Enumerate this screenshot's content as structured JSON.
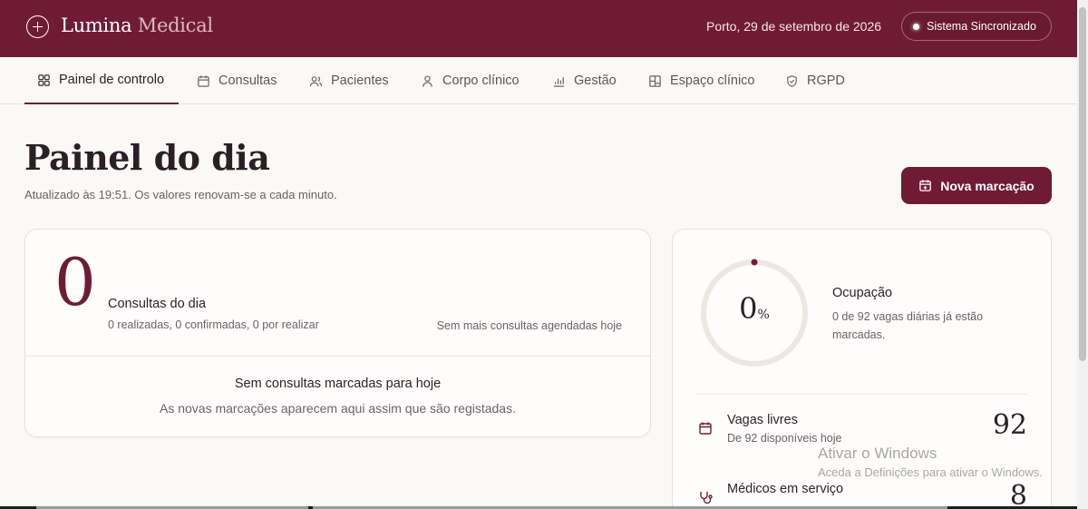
{
  "header": {
    "brand_primary": "Lumina",
    "brand_secondary": "Medical",
    "date": "Porto, 29 de setembro de 2026",
    "sync_status": "Sistema Sincronizado"
  },
  "nav": {
    "items": [
      {
        "label": "Painel de controlo",
        "icon": "dashboard-icon",
        "active": true
      },
      {
        "label": "Consultas",
        "icon": "calendar-icon"
      },
      {
        "label": "Pacientes",
        "icon": "users-icon"
      },
      {
        "label": "Corpo clínico",
        "icon": "user-icon"
      },
      {
        "label": "Gestão",
        "icon": "bar-chart-icon"
      },
      {
        "label": "Espaço clínico",
        "icon": "grid-icon"
      },
      {
        "label": "RGPD",
        "icon": "shield-icon"
      }
    ]
  },
  "page": {
    "title": "Painel do dia",
    "subtitle": "Atualizado às 19:51. Os valores renovam-se a cada minuto.",
    "new_button_label": "Nova marcação"
  },
  "consultations": {
    "count": "0",
    "title": "Consultas do dia",
    "detail": "0 realizadas, 0 confirmadas, 0 por realizar",
    "right_note": "Sem mais consultas agendadas hoje",
    "empty_title": "Sem consultas marcadas para hoje",
    "empty_subtitle": "As novas marcações aparecem aqui assim que são registadas."
  },
  "occupancy": {
    "value": "0",
    "unit": "%",
    "fraction": 0,
    "title": "Ocupação",
    "description": "0 de 92 vagas diárias já estão marcadas."
  },
  "stats": [
    {
      "title": "Vagas livres",
      "subtitle": "De 92 disponíveis hoje",
      "value": "92",
      "icon": "calendar-icon"
    },
    {
      "title": "Médicos em serviço",
      "subtitle": "",
      "value": "8",
      "icon": "stethoscope-icon"
    }
  ],
  "watermark": {
    "title": "Ativar o Windows",
    "subtitle": "Aceda a Definições para ativar o Windows."
  },
  "colors": {
    "brand": "#701b36",
    "background": "#fbf9f6",
    "gauge_track": "#ece7e0"
  }
}
